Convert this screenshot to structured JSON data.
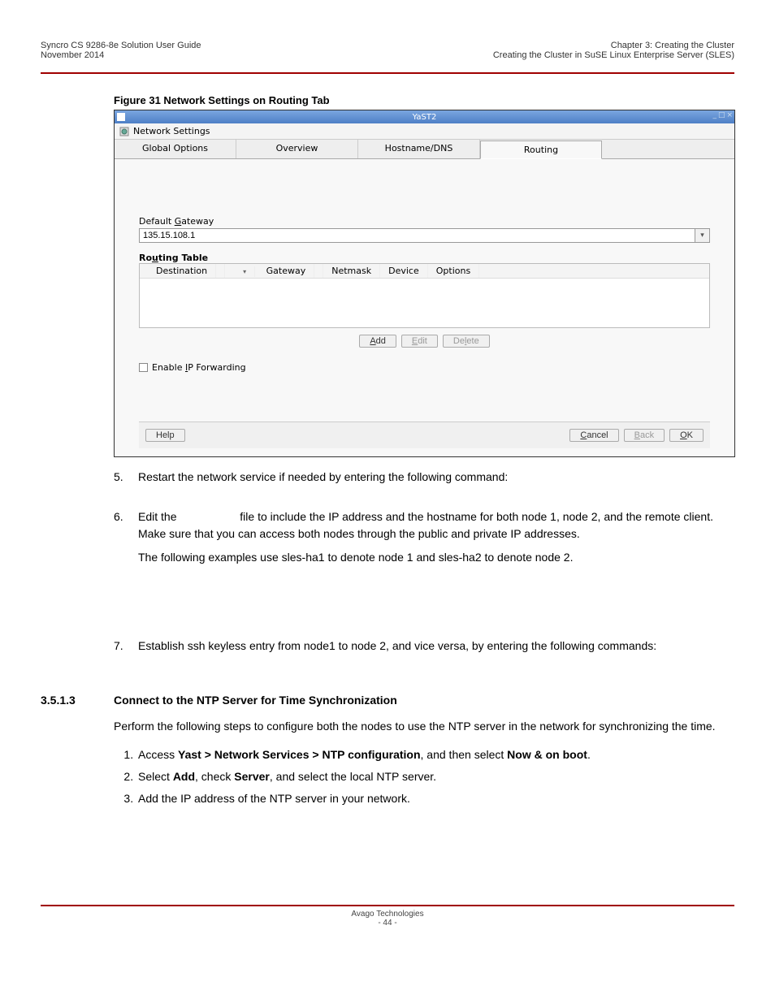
{
  "header": {
    "left_title": "Syncro CS 9286-8e Solution User Guide",
    "left_date": "November 2014",
    "right_chapter": "Chapter 3: Creating the Cluster",
    "right_section": "Creating the Cluster in SuSE Linux Enterprise Server (SLES)"
  },
  "figure": {
    "caption": "Figure 31  Network Settings on Routing Tab"
  },
  "yast": {
    "titlebar": "YaST2",
    "subheader": "Network Settings",
    "tabs": {
      "global": "Global Options",
      "overview": "Overview",
      "hostname": "Hostname/DNS",
      "routing": "Routing"
    },
    "gateway_label": "Default Gateway",
    "gateway_value": "135.15.108.1",
    "routing_table_label": "Routing Table",
    "rt_headers": {
      "destination": "Destination",
      "gateway": "Gateway",
      "netmask": "Netmask",
      "device": "Device",
      "options": "Options"
    },
    "buttons": {
      "add": "Add",
      "edit": "Edit",
      "delete": "Delete"
    },
    "ipfwd": "Enable IP Forwarding",
    "bottom": {
      "help": "Help",
      "cancel": "Cancel",
      "back": "Back",
      "ok": "OK"
    }
  },
  "steps": {
    "s5": "Restart the network service if needed by entering the following command:",
    "s6a_pre": "Edit the ",
    "s6a_post": " file to include the IP address and the hostname for both node 1, node 2, and the remote client. Make sure that you can access both nodes through the public and private IP addresses.",
    "s6b": "The following examples use sles-ha1 to denote node 1 and sles-ha2 to denote node 2.",
    "s7": "Establish ssh keyless entry from node1 to node 2, and vice versa, by entering the following commands:"
  },
  "section": {
    "num": "3.5.1.3",
    "title": "Connect to the NTP Server for Time Synchronization",
    "intro": "Perform the following steps to configure both the nodes to use the NTP server in the network for synchronizing the time.",
    "li1_a": "Access ",
    "li1_b": "Yast > Network Services > NTP configuration",
    "li1_c": ", and then select ",
    "li1_d": "Now & on boot",
    "li1_e": ".",
    "li2_a": "Select ",
    "li2_b": "Add",
    "li2_c": ", check ",
    "li2_d": "Server",
    "li2_e": ", and select the local NTP server.",
    "li3": "Add the IP address of the NTP server in your network."
  },
  "footer": {
    "company": "Avago Technologies",
    "page": "- 44 -"
  }
}
